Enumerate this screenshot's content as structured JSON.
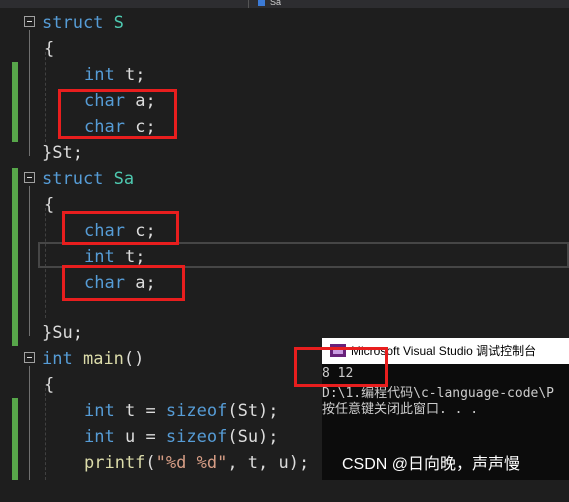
{
  "tab": {
    "label": "Sa"
  },
  "code": {
    "line1": {
      "kw": "struct",
      "name": "S"
    },
    "line2": {
      "text": "{"
    },
    "line3": {
      "kw": "int",
      "rest": "t;"
    },
    "line4": {
      "kw": "char",
      "rest": "a;"
    },
    "line5": {
      "kw": "char",
      "rest": "c;"
    },
    "line6": {
      "text": "}St;"
    },
    "line7": {
      "kw": "struct",
      "name": "Sa"
    },
    "line8": {
      "text": "{"
    },
    "line9": {
      "kw": "char",
      "rest": "c;"
    },
    "line10": {
      "kw": "int",
      "rest": "t;"
    },
    "line11": {
      "kw": "char",
      "rest": "a;"
    },
    "line12": {
      "text": "}Su;"
    },
    "line13": {
      "kw": "int",
      "fn": "main",
      "rest": "()"
    },
    "line14": {
      "text": "{"
    },
    "line15": {
      "kw": "int",
      "mid": "t = ",
      "fn": "sizeof",
      "rest": "(St);"
    },
    "line16": {
      "kw": "int",
      "mid": "u = ",
      "fn": "sizeof",
      "rest": "(Su);"
    },
    "line17": {
      "fn": "printf",
      "open": "(",
      "str": "\"%d %d\"",
      "rest": ", t, u);"
    }
  },
  "console": {
    "title": "Microsoft Visual Studio 调试控制台",
    "output": "8 12",
    "path": "D:\\1.编程代码\\c-language-code\\P",
    "close_msg": "按任意键关闭此窗口. . ."
  },
  "watermark": "CSDN @日向晚，声声慢",
  "colors": {
    "keyword": "#569cd6",
    "type_name": "#4ec9b0",
    "function": "#dcdcaa",
    "string": "#d69d85",
    "highlight_box": "#e81e1e",
    "change_bar": "#57a64a"
  }
}
